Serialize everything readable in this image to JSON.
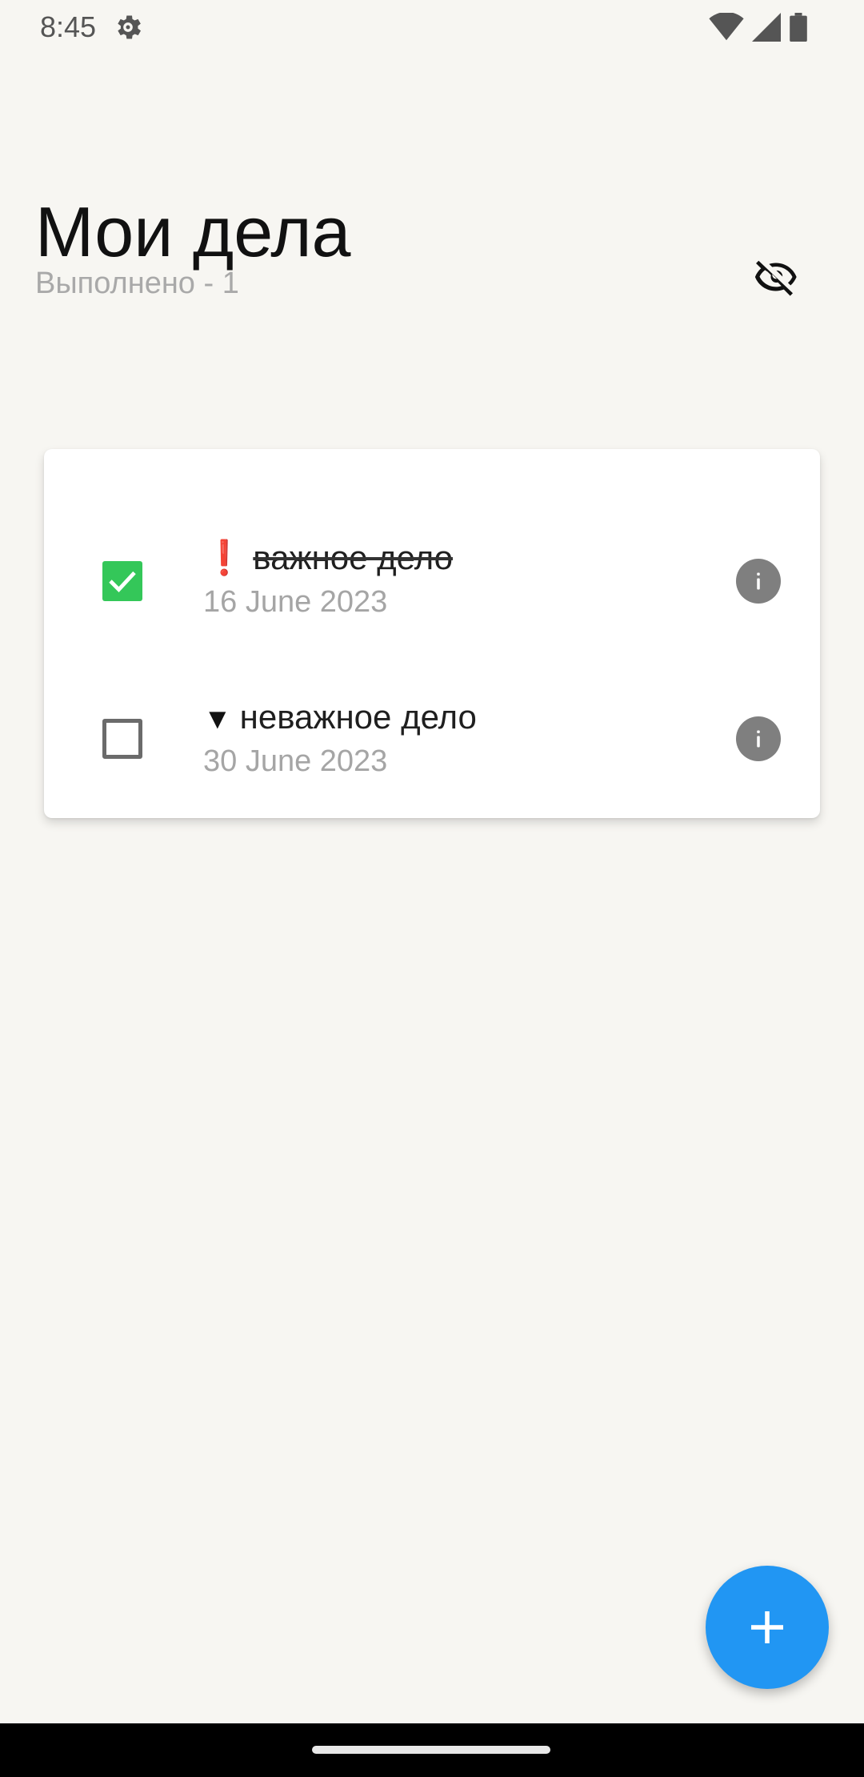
{
  "status_bar": {
    "time": "8:45",
    "icons": [
      "settings-icon",
      "wifi-icon",
      "cell-signal-icon",
      "battery-icon"
    ]
  },
  "header": {
    "title": "Мои дела",
    "done_counter": "Выполнено - 1",
    "visibility_icon": "visibility-off-icon"
  },
  "tasks": [
    {
      "priority_icon": "❗",
      "title": "важное дело",
      "date": "16 June 2023",
      "done": true
    },
    {
      "priority_icon": "▼",
      "title": "неважное дело",
      "date": "30 June 2023",
      "done": false
    }
  ],
  "fab": {
    "icon": "plus-icon"
  },
  "colors": {
    "background": "#f7f6f2",
    "checked": "#34c759",
    "fab": "#2196f3",
    "priority_high": "#e53935",
    "muted_text": "#a5a5a5"
  }
}
